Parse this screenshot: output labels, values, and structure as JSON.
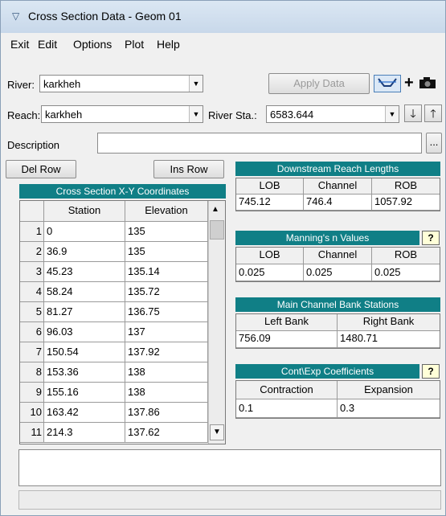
{
  "window": {
    "title": "Cross Section Data - Geom 01"
  },
  "menu": [
    "Exit",
    "Edit",
    "Options",
    "Plot",
    "Help"
  ],
  "river": {
    "label": "River:",
    "value": "karkheh"
  },
  "reach": {
    "label": "Reach:",
    "value": "karkheh"
  },
  "river_sta": {
    "label": "River Sta.:",
    "value": "6583.644"
  },
  "apply_label": "Apply Data",
  "description": {
    "label": "Description",
    "value": "",
    "browse": "..."
  },
  "del_row": "Del Row",
  "ins_row": "Ins Row",
  "xy": {
    "title": "Cross Section X-Y Coordinates",
    "col_station": "Station",
    "col_elevation": "Elevation",
    "rows": [
      {
        "n": "1",
        "station": "0",
        "elev": "135"
      },
      {
        "n": "2",
        "station": "36.9",
        "elev": "135"
      },
      {
        "n": "3",
        "station": "45.23",
        "elev": "135.14"
      },
      {
        "n": "4",
        "station": "58.24",
        "elev": "135.72"
      },
      {
        "n": "5",
        "station": "81.27",
        "elev": "136.75"
      },
      {
        "n": "6",
        "station": "96.03",
        "elev": "137"
      },
      {
        "n": "7",
        "station": "150.54",
        "elev": "137.92"
      },
      {
        "n": "8",
        "station": "153.36",
        "elev": "138"
      },
      {
        "n": "9",
        "station": "155.16",
        "elev": "138"
      },
      {
        "n": "10",
        "station": "163.42",
        "elev": "137.86"
      },
      {
        "n": "11",
        "station": "214.3",
        "elev": "137.62"
      }
    ]
  },
  "downstream": {
    "title": "Downstream Reach Lengths",
    "cols": [
      "LOB",
      "Channel",
      "ROB"
    ],
    "values": [
      "745.12",
      "746.4",
      "1057.92"
    ]
  },
  "manning": {
    "title": "Manning's n Values",
    "cols": [
      "LOB",
      "Channel",
      "ROB"
    ],
    "values": [
      "0.025",
      "0.025",
      "0.025"
    ],
    "help": "?"
  },
  "bank": {
    "title": "Main Channel Bank Stations",
    "cols": [
      "Left Bank",
      "Right Bank"
    ],
    "values": [
      "756.09",
      "1480.71"
    ]
  },
  "contexp": {
    "title": "Cont\\Exp  Coefficients",
    "cols": [
      "Contraction",
      "Expansion"
    ],
    "values": [
      "0.1",
      "0.3"
    ],
    "help": "?"
  },
  "status_text": ""
}
